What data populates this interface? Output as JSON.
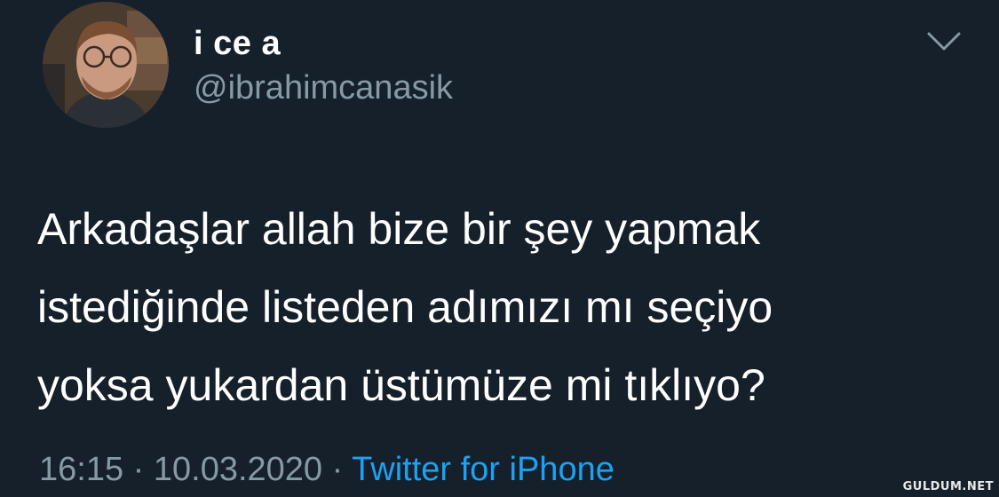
{
  "tweet": {
    "author": {
      "display_name": "i ce a",
      "handle": "@ibrahimcanasik",
      "avatar_icon": "profile-photo"
    },
    "menu_icon": "chevron-down-icon",
    "text_lines": [
      "Arkadaşlar allah bize bir şey yapmak",
      "istediğinde listeden adımızı mı seçiyo",
      "yoksa yukardan üstümüze mi tıklıyo?"
    ],
    "meta": {
      "time": "16:15",
      "separator": "·",
      "date": "10.03.2020",
      "source": "Twitter for iPhone"
    }
  },
  "watermark": "GULDUM.NET",
  "colors": {
    "background": "#15202b",
    "primary_text": "#ffffff",
    "secondary_text": "#8899a6",
    "link": "#1da1f2"
  }
}
